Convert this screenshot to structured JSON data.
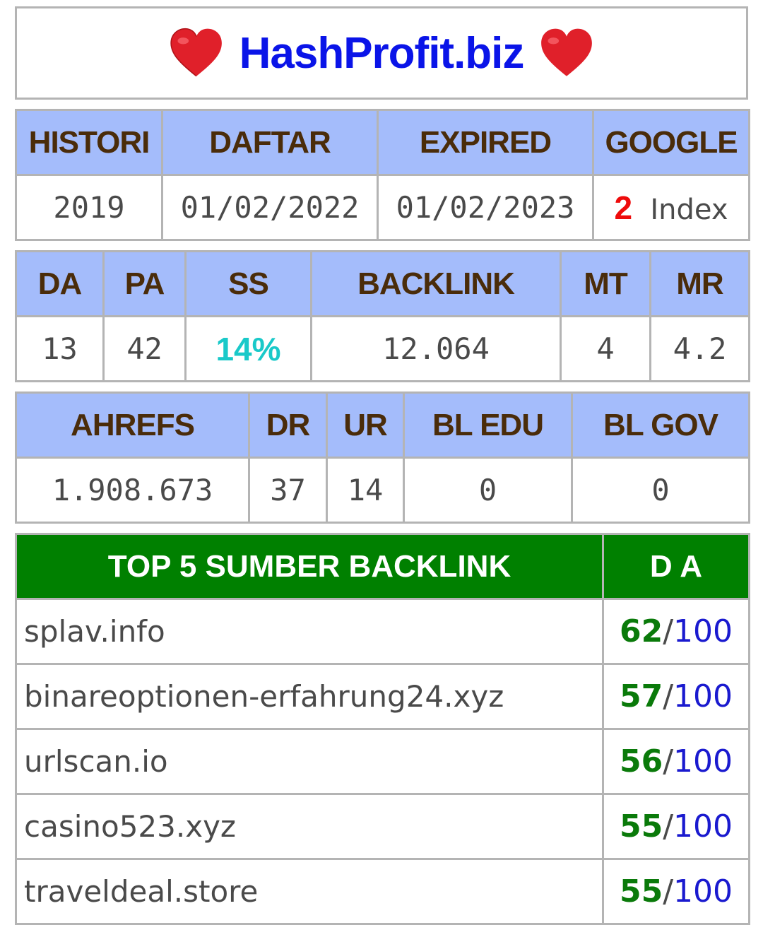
{
  "title": "HashProfit.biz",
  "title_icon": "red-heart",
  "info": {
    "headers": [
      "HISTORI",
      "DAFTAR",
      "EXPIRED",
      "GOOGLE"
    ],
    "histori": "2019",
    "daftar": "01/02/2022",
    "expired": "01/02/2023",
    "google_count": "2",
    "google_label": "Index"
  },
  "moz": {
    "headers": [
      "DA",
      "PA",
      "SS",
      "BACKLINK",
      "MT",
      "MR"
    ],
    "da": "13",
    "pa": "42",
    "ss": "14%",
    "backlink": "12.064",
    "mt": "4",
    "mr": "4.2"
  },
  "ahrefs": {
    "headers": [
      "AHREFS",
      "DR",
      "UR",
      "BL EDU",
      "BL GOV"
    ],
    "ahrefs": "1.908.673",
    "dr": "37",
    "ur": "14",
    "bl_edu": "0",
    "bl_gov": "0"
  },
  "top_backlinks": {
    "header_source": "TOP 5 SUMBER BACKLINK",
    "header_da": "D A",
    "rows": [
      {
        "site": "splav.info",
        "da": "62",
        "slash": "/",
        "max": "100"
      },
      {
        "site": "binareoptionen-erfahrung24.xyz",
        "da": "57",
        "slash": "/",
        "max": "100"
      },
      {
        "site": "urlscan.io",
        "da": "56",
        "slash": "/",
        "max": "100"
      },
      {
        "site": "casino523.xyz",
        "da": "55",
        "slash": "/",
        "max": "100"
      },
      {
        "site": "traveldeal.store",
        "da": "55",
        "slash": "/",
        "max": "100"
      }
    ]
  },
  "colors": {
    "title": "#0a14e8",
    "header_bg": "#a4bcfb",
    "header_text": "#4a2c0a",
    "green_header_bg": "#008000",
    "google_count": "#ee0b0b",
    "ss_value": "#19c9c9",
    "da_value": "#0a7a0a",
    "da_max": "#1a1acf"
  }
}
